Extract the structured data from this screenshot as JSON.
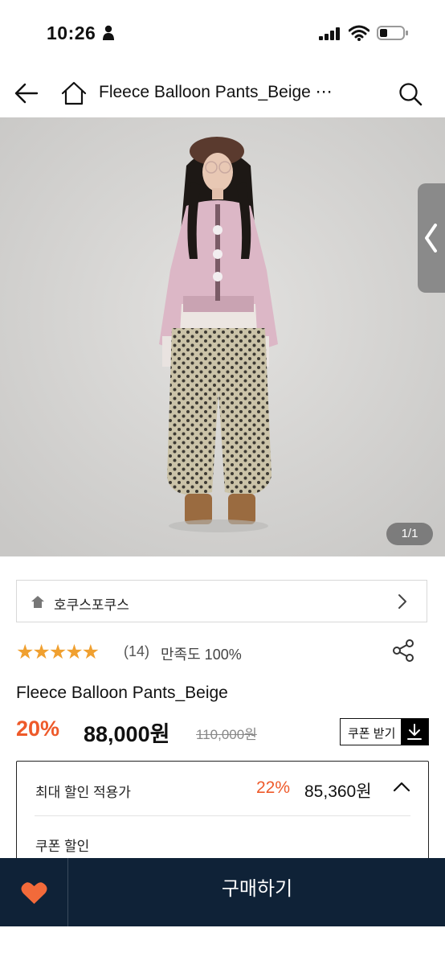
{
  "status_bar": {
    "time": "10:26"
  },
  "header": {
    "title": "Fleece Balloon Pants_Beige ⋯"
  },
  "gallery": {
    "counter": "1/1"
  },
  "brand": {
    "name": "호쿠스포쿠스"
  },
  "rating": {
    "stars": "★★★★★",
    "value": 5,
    "max": 5,
    "reviews": "(14)",
    "satisfaction": "만족도 100%"
  },
  "product": {
    "title": "Fleece Balloon Pants_Beige",
    "discount": "20%",
    "price": "88,000원",
    "original_price": "110,000원"
  },
  "coupon": {
    "label": "쿠폰 받기"
  },
  "max_discount": {
    "label": "최대 할인 적용가",
    "rate": "22%",
    "price": "85,360원",
    "coupon_label": "쿠폰 할인"
  },
  "bottom": {
    "buy_label": "구매하기"
  },
  "colors": {
    "accent": "#ee5a2a",
    "star": "#f0a030",
    "bottom_bar": "#0f2237",
    "heart": "#f26a3a"
  }
}
